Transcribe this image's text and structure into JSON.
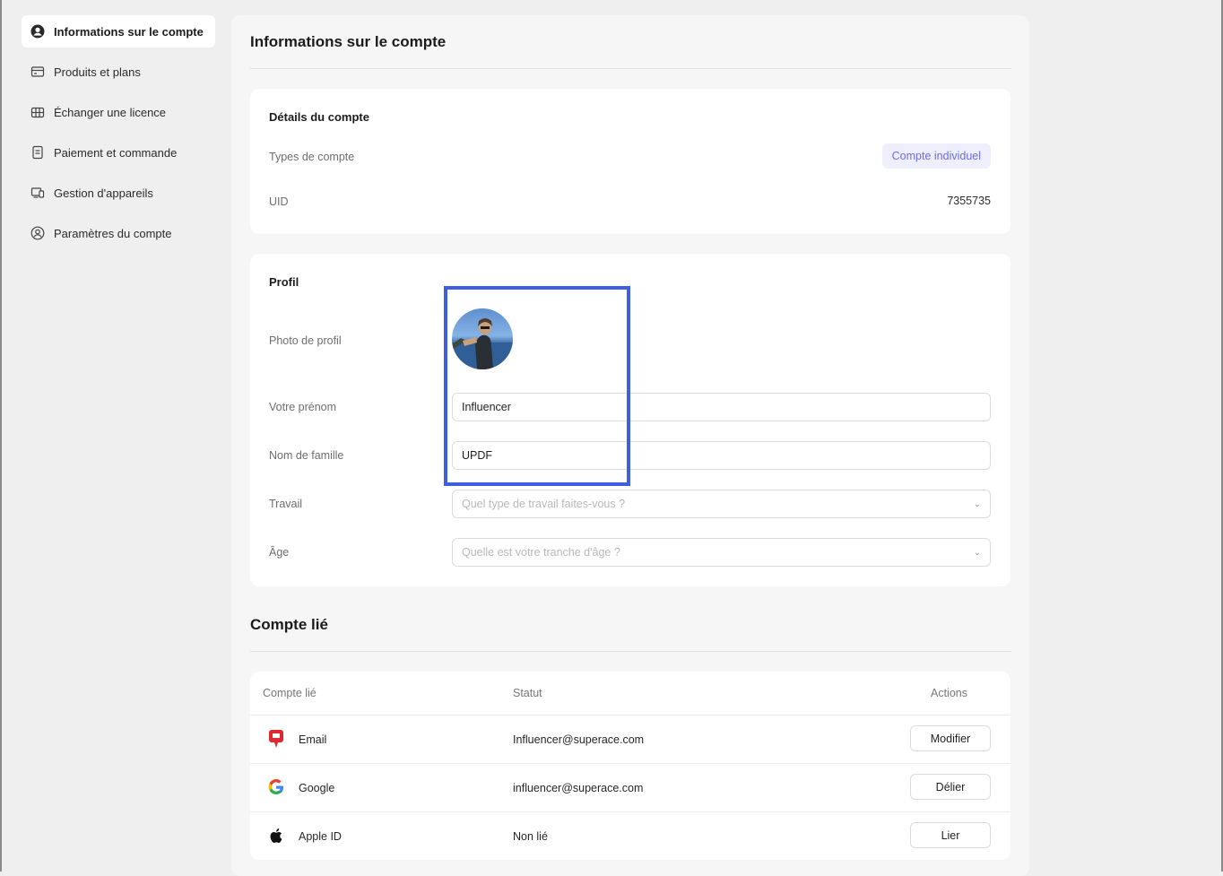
{
  "sidebar": {
    "items": [
      {
        "label": "Informations sur le compte",
        "icon": "user-circle-icon"
      },
      {
        "label": "Produits et plans",
        "icon": "credit-card-icon"
      },
      {
        "label": "Échanger une licence",
        "icon": "gift-icon"
      },
      {
        "label": "Paiement et commande",
        "icon": "receipt-icon"
      },
      {
        "label": "Gestion d'appareils",
        "icon": "devices-icon"
      },
      {
        "label": "Paramètres du compte",
        "icon": "user-settings-icon"
      }
    ]
  },
  "main": {
    "title": "Informations sur le compte",
    "account_details": {
      "title": "Détails du compte",
      "account_type_label": "Types de compte",
      "account_type_value": "Compte individuel",
      "uid_label": "UID",
      "uid_value": "7355735"
    },
    "profile": {
      "title": "Profil",
      "photo_label": "Photo de profil",
      "first_name_label": "Votre prénom",
      "first_name_value": "Influencer",
      "last_name_label": "Nom de famille",
      "last_name_value": "UPDF",
      "job_label": "Travail",
      "job_placeholder": "Quel type de travail faites-vous ?",
      "age_label": "Âge",
      "age_placeholder": "Quelle est votre tranche d'âge ?"
    },
    "linked": {
      "title": "Compte lié",
      "headers": {
        "account": "Compte lié",
        "status": "Statut",
        "actions": "Actions"
      },
      "rows": [
        {
          "name": "Email",
          "status": "Influencer@superace.com",
          "action": "Modifier",
          "icon": "email-icon"
        },
        {
          "name": "Google",
          "status": "influencer@superace.com",
          "action": "Délier",
          "icon": "google-icon"
        },
        {
          "name": "Apple ID",
          "status": "Non lié",
          "action": "Lier",
          "icon": "apple-icon"
        }
      ]
    }
  },
  "colors": {
    "accent": "#6a6ee8",
    "highlight_border": "#3e60e0",
    "background": "#efefef"
  }
}
